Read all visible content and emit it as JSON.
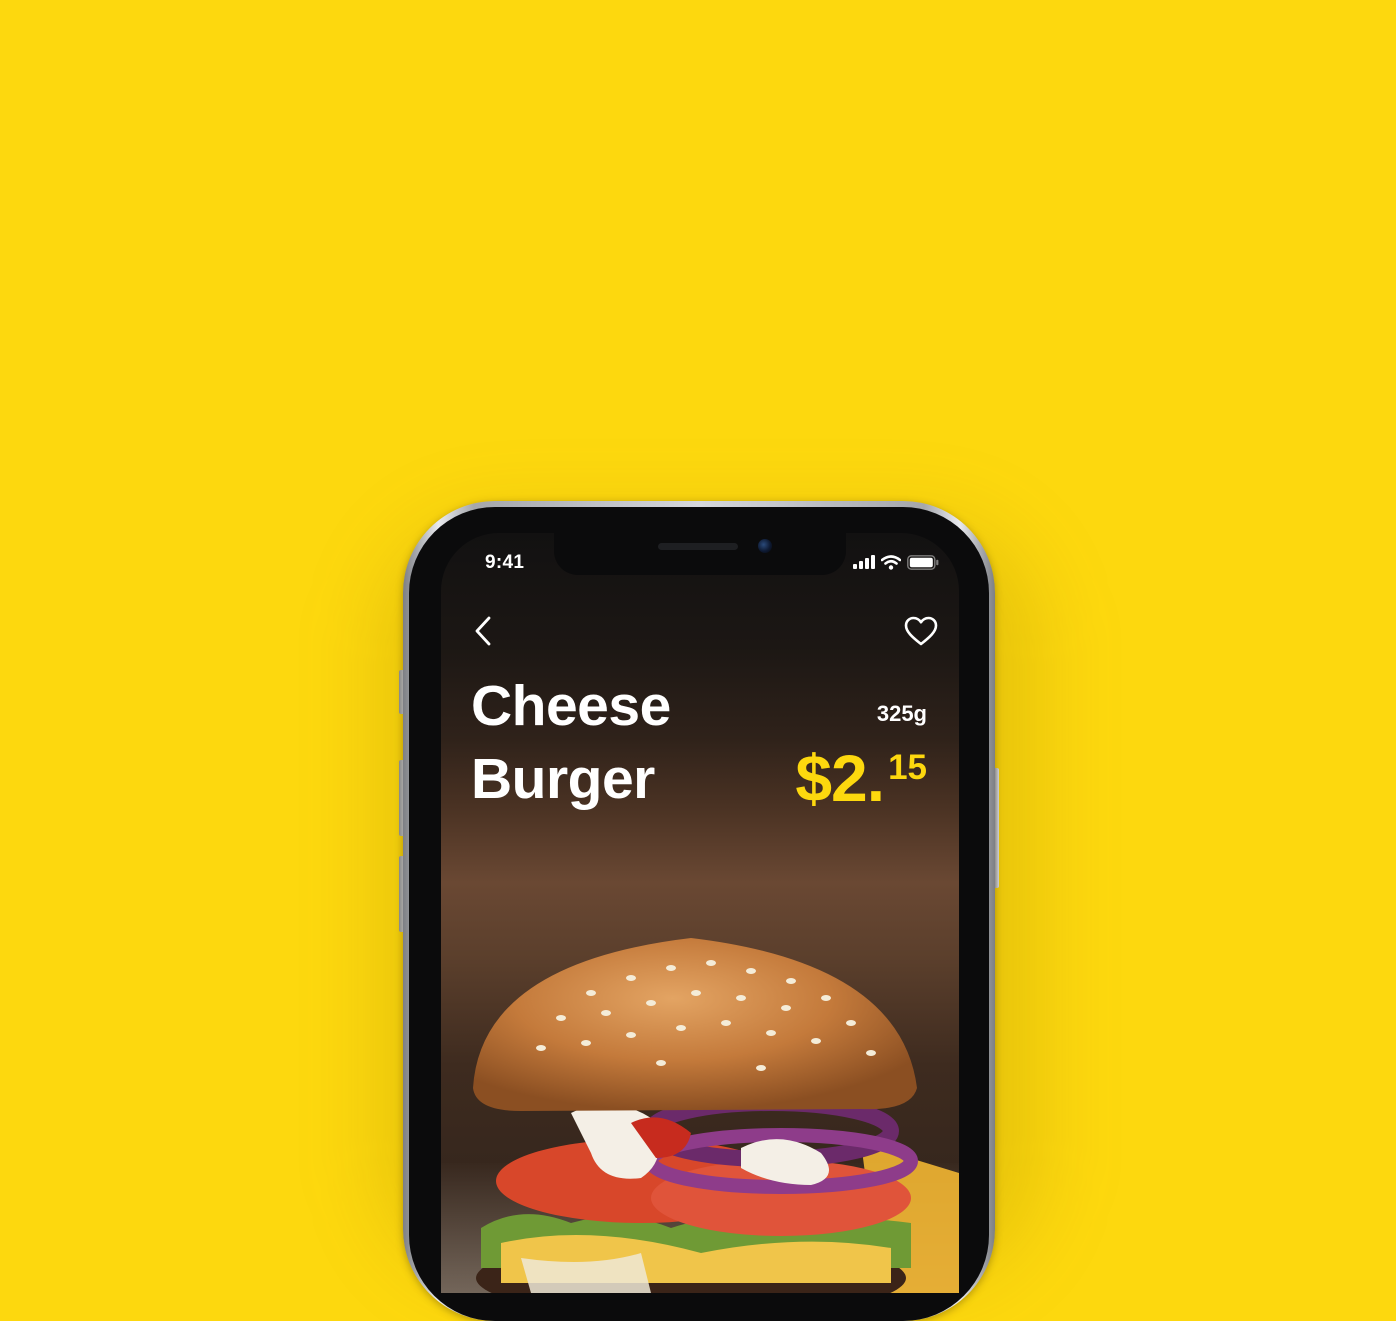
{
  "status_bar": {
    "time": "9:41"
  },
  "product": {
    "name_line1": "Cheese",
    "name_line2": "Burger",
    "weight": "325g",
    "price_main": "$2.",
    "price_cents": "15"
  },
  "icons": {
    "back": "chevron-left-icon",
    "favorite": "heart-outline-icon",
    "signal": "cellular-signal-icon",
    "wifi": "wifi-icon",
    "battery": "battery-icon"
  },
  "colors": {
    "background": "#FDD80E",
    "accent": "#FDD80E",
    "screen_dark": "#121111",
    "text": "#FFFFFF"
  }
}
